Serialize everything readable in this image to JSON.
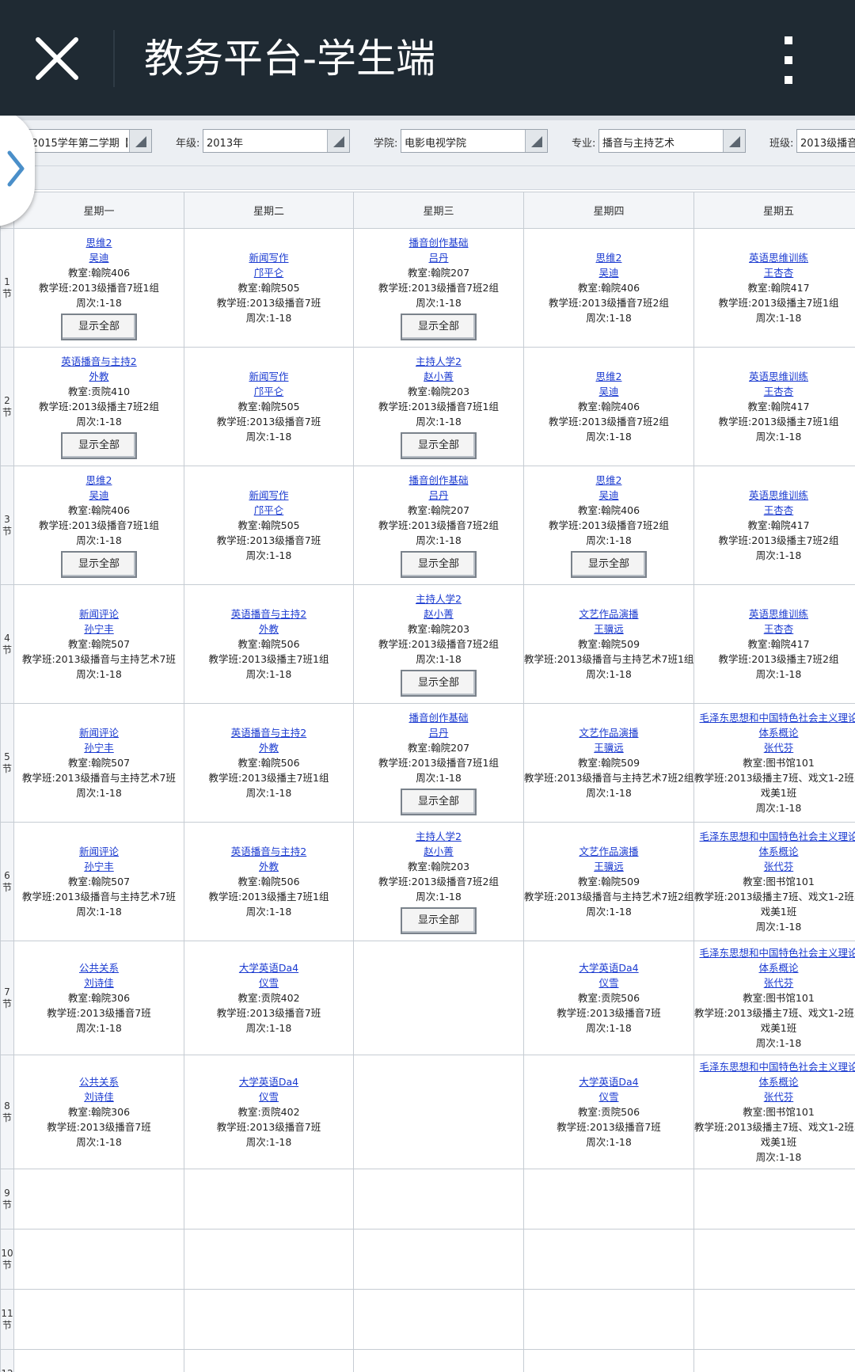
{
  "app_bar": {
    "title": "教务平台-学生端",
    "close_icon": "close-icon",
    "more_icon": "more-vertical-icon",
    "background": "#1f2a33"
  },
  "filters": {
    "term": {
      "value": "-2015学年第二学期【"
    },
    "grade": {
      "label": "年级:",
      "value": "2013年"
    },
    "college": {
      "label": "学院:",
      "value": "电影电视学院"
    },
    "major": {
      "label": "专业:",
      "value": "播音与主持艺术"
    },
    "class": {
      "label": "班级:",
      "value": "2013级播音"
    }
  },
  "side_handle": {
    "icon": "chevron-right-icon",
    "color": "#4a8fc9"
  },
  "timetable": {
    "days": [
      "星期一",
      "星期二",
      "星期三",
      "星期四",
      "星期五"
    ],
    "show_all_label": "显示全部",
    "link_color": "#1a3ad0",
    "sections": [
      {
        "label": "1节",
        "cells": [
          {
            "course": "思维2",
            "teacher": "吴迪",
            "room": "教室:翰院406",
            "cls": "教学班:2013级播音7班1组",
            "weeks": "周次:1-18",
            "show_all": true
          },
          {
            "course": "新闻写作",
            "teacher": "邝平仑",
            "room": "教室:翰院505",
            "cls": "教学班:2013级播音7班",
            "weeks": "周次:1-18"
          },
          {
            "course": "播音创作基础",
            "teacher": "吕丹",
            "room": "教室:翰院207",
            "cls": "教学班:2013级播音7班2组",
            "weeks": "周次:1-18",
            "show_all": true
          },
          {
            "course": "思维2",
            "teacher": "吴迪",
            "room": "教室:翰院406",
            "cls": "教学班:2013级播音7班2组",
            "weeks": "周次:1-18"
          },
          {
            "course": "英语思维训练",
            "teacher": "王杏杏",
            "room": "教室:翰院417",
            "cls": "教学班:2013级播主7班1组",
            "weeks": "周次:1-18"
          }
        ]
      },
      {
        "label": "2节",
        "cells": [
          {
            "course": "英语播音与主持2",
            "teacher": "外教",
            "room": "教室:贡院410",
            "cls": "教学班:2013级播主7班2组",
            "weeks": "周次:1-18",
            "show_all": true
          },
          {
            "course": "新闻写作",
            "teacher": "邝平仑",
            "room": "教室:翰院505",
            "cls": "教学班:2013级播音7班",
            "weeks": "周次:1-18"
          },
          {
            "course": "主持人学2",
            "teacher": "赵小菁",
            "room": "教室:翰院203",
            "cls": "教学班:2013级播音7班1组",
            "weeks": "周次:1-18",
            "show_all": true
          },
          {
            "course": "思维2",
            "teacher": "吴迪",
            "room": "教室:翰院406",
            "cls": "教学班:2013级播音7班2组",
            "weeks": "周次:1-18"
          },
          {
            "course": "英语思维训练",
            "teacher": "王杏杏",
            "room": "教室:翰院417",
            "cls": "教学班:2013级播主7班1组",
            "weeks": "周次:1-18"
          }
        ]
      },
      {
        "label": "3节",
        "cells": [
          {
            "course": "思维2",
            "teacher": "吴迪",
            "room": "教室:翰院406",
            "cls": "教学班:2013级播音7班1组",
            "weeks": "周次:1-18",
            "show_all": true
          },
          {
            "course": "新闻写作",
            "teacher": "邝平仑",
            "room": "教室:翰院505",
            "cls": "教学班:2013级播音7班",
            "weeks": "周次:1-18"
          },
          {
            "course": "播音创作基础",
            "teacher": "吕丹",
            "room": "教室:翰院207",
            "cls": "教学班:2013级播音7班2组",
            "weeks": "周次:1-18",
            "show_all": true
          },
          {
            "course": "思维2",
            "teacher": "吴迪",
            "room": "教室:翰院406",
            "cls": "教学班:2013级播音7班2组",
            "weeks": "周次:1-18",
            "show_all": true
          },
          {
            "course": "英语思维训练",
            "teacher": "王杏杏",
            "room": "教室:翰院417",
            "cls": "教学班:2013级播主7班2组",
            "weeks": "周次:1-18"
          }
        ]
      },
      {
        "label": "4节",
        "cells": [
          {
            "course": "新闻评论",
            "teacher": "孙宁丰",
            "room": "教室:翰院507",
            "cls": "教学班:2013级播音与主持艺术7班",
            "weeks": "周次:1-18"
          },
          {
            "course": "英语播音与主持2",
            "teacher": "外教",
            "room": "教室:翰院506",
            "cls": "教学班:2013级播主7班1组",
            "weeks": "周次:1-18"
          },
          {
            "course": "主持人学2",
            "teacher": "赵小菁",
            "room": "教室:翰院203",
            "cls": "教学班:2013级播音7班2组",
            "weeks": "周次:1-18",
            "show_all": true
          },
          {
            "course": "文艺作品演播",
            "teacher": "王骥远",
            "room": "教室:翰院509",
            "cls": "教学班:2013级播音与主持艺术7班1组",
            "weeks": "周次:1-18"
          },
          {
            "course": "英语思维训练",
            "teacher": "王杏杏",
            "room": "教室:翰院417",
            "cls": "教学班:2013级播主7班2组",
            "weeks": "周次:1-18"
          }
        ]
      },
      {
        "label": "5节",
        "cells": [
          {
            "course": "新闻评论",
            "teacher": "孙宁丰",
            "room": "教室:翰院507",
            "cls": "教学班:2013级播音与主持艺术7班",
            "weeks": "周次:1-18"
          },
          {
            "course": "英语播音与主持2",
            "teacher": "外教",
            "room": "教室:翰院506",
            "cls": "教学班:2013级播主7班1组",
            "weeks": "周次:1-18"
          },
          {
            "course": "播音创作基础",
            "teacher": "吕丹",
            "room": "教室:翰院207",
            "cls": "教学班:2013级播音7班1组",
            "weeks": "周次:1-18",
            "show_all": true
          },
          {
            "course": "文艺作品演播",
            "teacher": "王骥远",
            "room": "教室:翰院509",
            "cls": "教学班:2013级播音与主持艺术7班2组",
            "weeks": "周次:1-18"
          },
          {
            "course": "毛泽东思想和中国特色社会主义理论",
            "course2": "体系概论",
            "teacher": "张代芬",
            "room": "教室:图书馆101",
            "cls": "教学班:2013级播主7班、戏文1-2班、",
            "cls2": "戏美1班",
            "weeks": "周次:1-18"
          }
        ]
      },
      {
        "label": "6节",
        "cells": [
          {
            "course": "新闻评论",
            "teacher": "孙宁丰",
            "room": "教室:翰院507",
            "cls": "教学班:2013级播音与主持艺术7班",
            "weeks": "周次:1-18"
          },
          {
            "course": "英语播音与主持2",
            "teacher": "外教",
            "room": "教室:翰院506",
            "cls": "教学班:2013级播主7班1组",
            "weeks": "周次:1-18"
          },
          {
            "course": "主持人学2",
            "teacher": "赵小菁",
            "room": "教室:翰院203",
            "cls": "教学班:2013级播音7班2组",
            "weeks": "周次:1-18",
            "show_all": true
          },
          {
            "course": "文艺作品演播",
            "teacher": "王骥远",
            "room": "教室:翰院509",
            "cls": "教学班:2013级播音与主持艺术7班2组",
            "weeks": "周次:1-18"
          },
          {
            "course": "毛泽东思想和中国特色社会主义理论",
            "course2": "体系概论",
            "teacher": "张代芬",
            "room": "教室:图书馆101",
            "cls": "教学班:2013级播主7班、戏文1-2班、",
            "cls2": "戏美1班",
            "weeks": "周次:1-18"
          }
        ]
      },
      {
        "label": "7节",
        "cells": [
          {
            "course": "公共关系",
            "teacher": "刘诗佳",
            "room": "教室:翰院306",
            "cls": "教学班:2013级播音7班",
            "weeks": "周次:1-18"
          },
          {
            "course": "大学英语Da4",
            "teacher": "仪雪",
            "room": "教室:贡院402",
            "cls": "教学班:2013级播音7班",
            "weeks": "周次:1-18"
          },
          null,
          {
            "course": "大学英语Da4",
            "teacher": "仪雪",
            "room": "教室:贡院506",
            "cls": "教学班:2013级播音7班",
            "weeks": "周次:1-18"
          },
          {
            "course": "毛泽东思想和中国特色社会主义理论",
            "course2": "体系概论",
            "teacher": "张代芬",
            "room": "教室:图书馆101",
            "cls": "教学班:2013级播主7班、戏文1-2班、",
            "cls2": "戏美1班",
            "weeks": "周次:1-18"
          }
        ]
      },
      {
        "label": "8节",
        "cells": [
          {
            "course": "公共关系",
            "teacher": "刘诗佳",
            "room": "教室:翰院306",
            "cls": "教学班:2013级播音7班",
            "weeks": "周次:1-18"
          },
          {
            "course": "大学英语Da4",
            "teacher": "仪雪",
            "room": "教室:贡院402",
            "cls": "教学班:2013级播音7班",
            "weeks": "周次:1-18"
          },
          null,
          {
            "course": "大学英语Da4",
            "teacher": "仪雪",
            "room": "教室:贡院506",
            "cls": "教学班:2013级播音7班",
            "weeks": "周次:1-18"
          },
          {
            "course": "毛泽东思想和中国特色社会主义理论",
            "course2": "体系概论",
            "teacher": "张代芬",
            "room": "教室:图书馆101",
            "cls": "教学班:2013级播主7班、戏文1-2班、",
            "cls2": "戏美1班",
            "weeks": "周次:1-18"
          }
        ]
      },
      {
        "label": "9节",
        "cells": [
          null,
          null,
          null,
          null,
          null
        ]
      },
      {
        "label": "10节",
        "cells": [
          null,
          null,
          null,
          null,
          null
        ]
      },
      {
        "label": "11节",
        "cells": [
          null,
          null,
          null,
          null,
          null
        ]
      },
      {
        "label": "12节",
        "cells": [
          null,
          null,
          null,
          null,
          null
        ]
      }
    ]
  }
}
